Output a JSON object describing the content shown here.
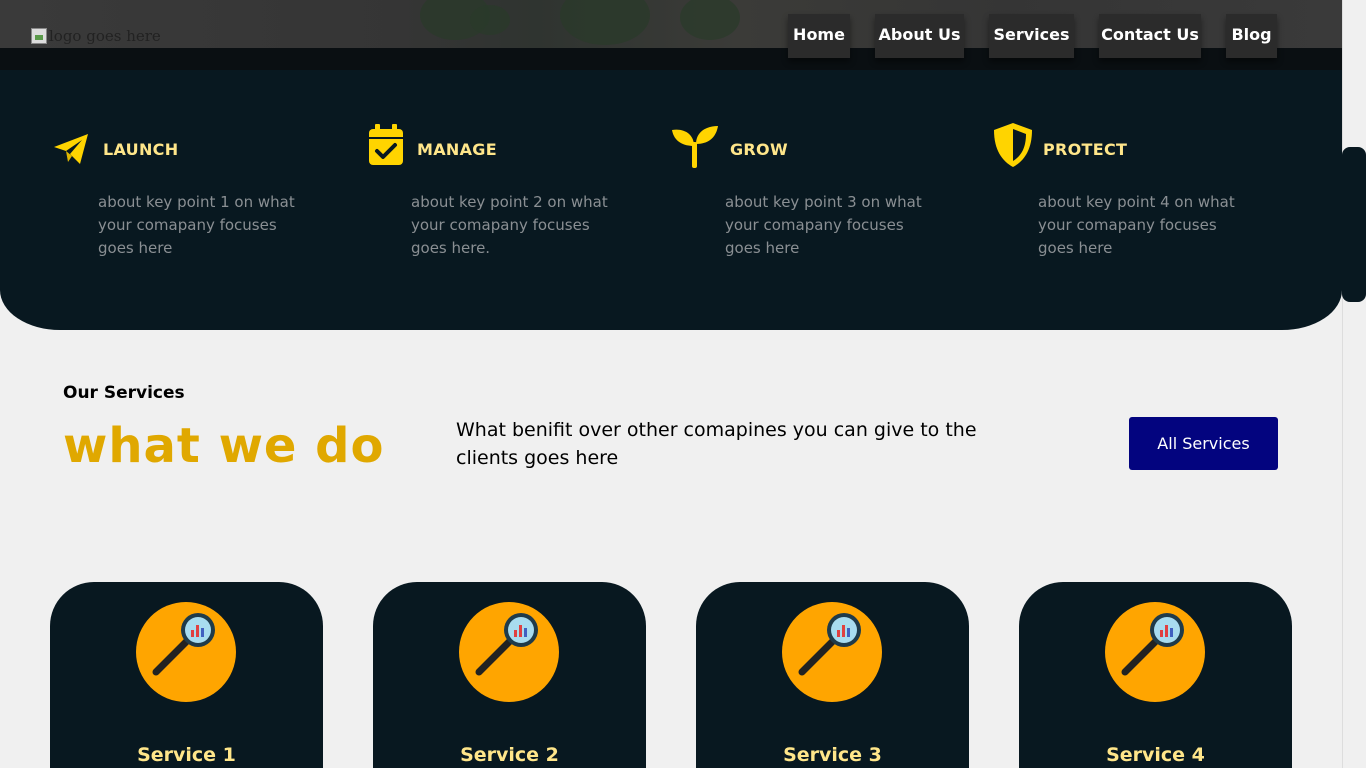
{
  "header": {
    "logo_alt": "logo goes here",
    "nav": [
      {
        "label": "Home"
      },
      {
        "label": "About Us"
      },
      {
        "label": "Services"
      },
      {
        "label": "Contact Us"
      },
      {
        "label": "Blog"
      }
    ]
  },
  "key_points": [
    {
      "icon": "paper-plane-icon",
      "title": "LAUNCH",
      "text": "about key point 1 on what your comapany focuses goes here"
    },
    {
      "icon": "calendar-check-icon",
      "title": "MANAGE",
      "text": "about key point 2 on what your comapany focuses goes here."
    },
    {
      "icon": "sprout-icon",
      "title": "GROW",
      "text": "about key point 3 on what your comapany focuses goes here"
    },
    {
      "icon": "shield-icon",
      "title": "PROTECT",
      "text": "about key point 4 on what your comapany focuses goes here"
    }
  ],
  "services_intro": {
    "eyebrow": "Our Services",
    "headline": "what we do",
    "blurb": "What benifit over other comapines you can give to the clients goes here",
    "button_label": "All Services"
  },
  "services": [
    {
      "icon": "magnifier-chart-icon",
      "title": "Service 1"
    },
    {
      "icon": "magnifier-chart-icon",
      "title": "Service 2"
    },
    {
      "icon": "magnifier-chart-icon",
      "title": "Service 3"
    },
    {
      "icon": "magnifier-chart-icon",
      "title": "Service 4"
    }
  ],
  "colors": {
    "accent_yellow": "#ffd400",
    "headline_gold": "#e0a800",
    "dark_navy": "#081820",
    "button_blue": "#03047f",
    "card_circle_orange": "#ffa500"
  }
}
